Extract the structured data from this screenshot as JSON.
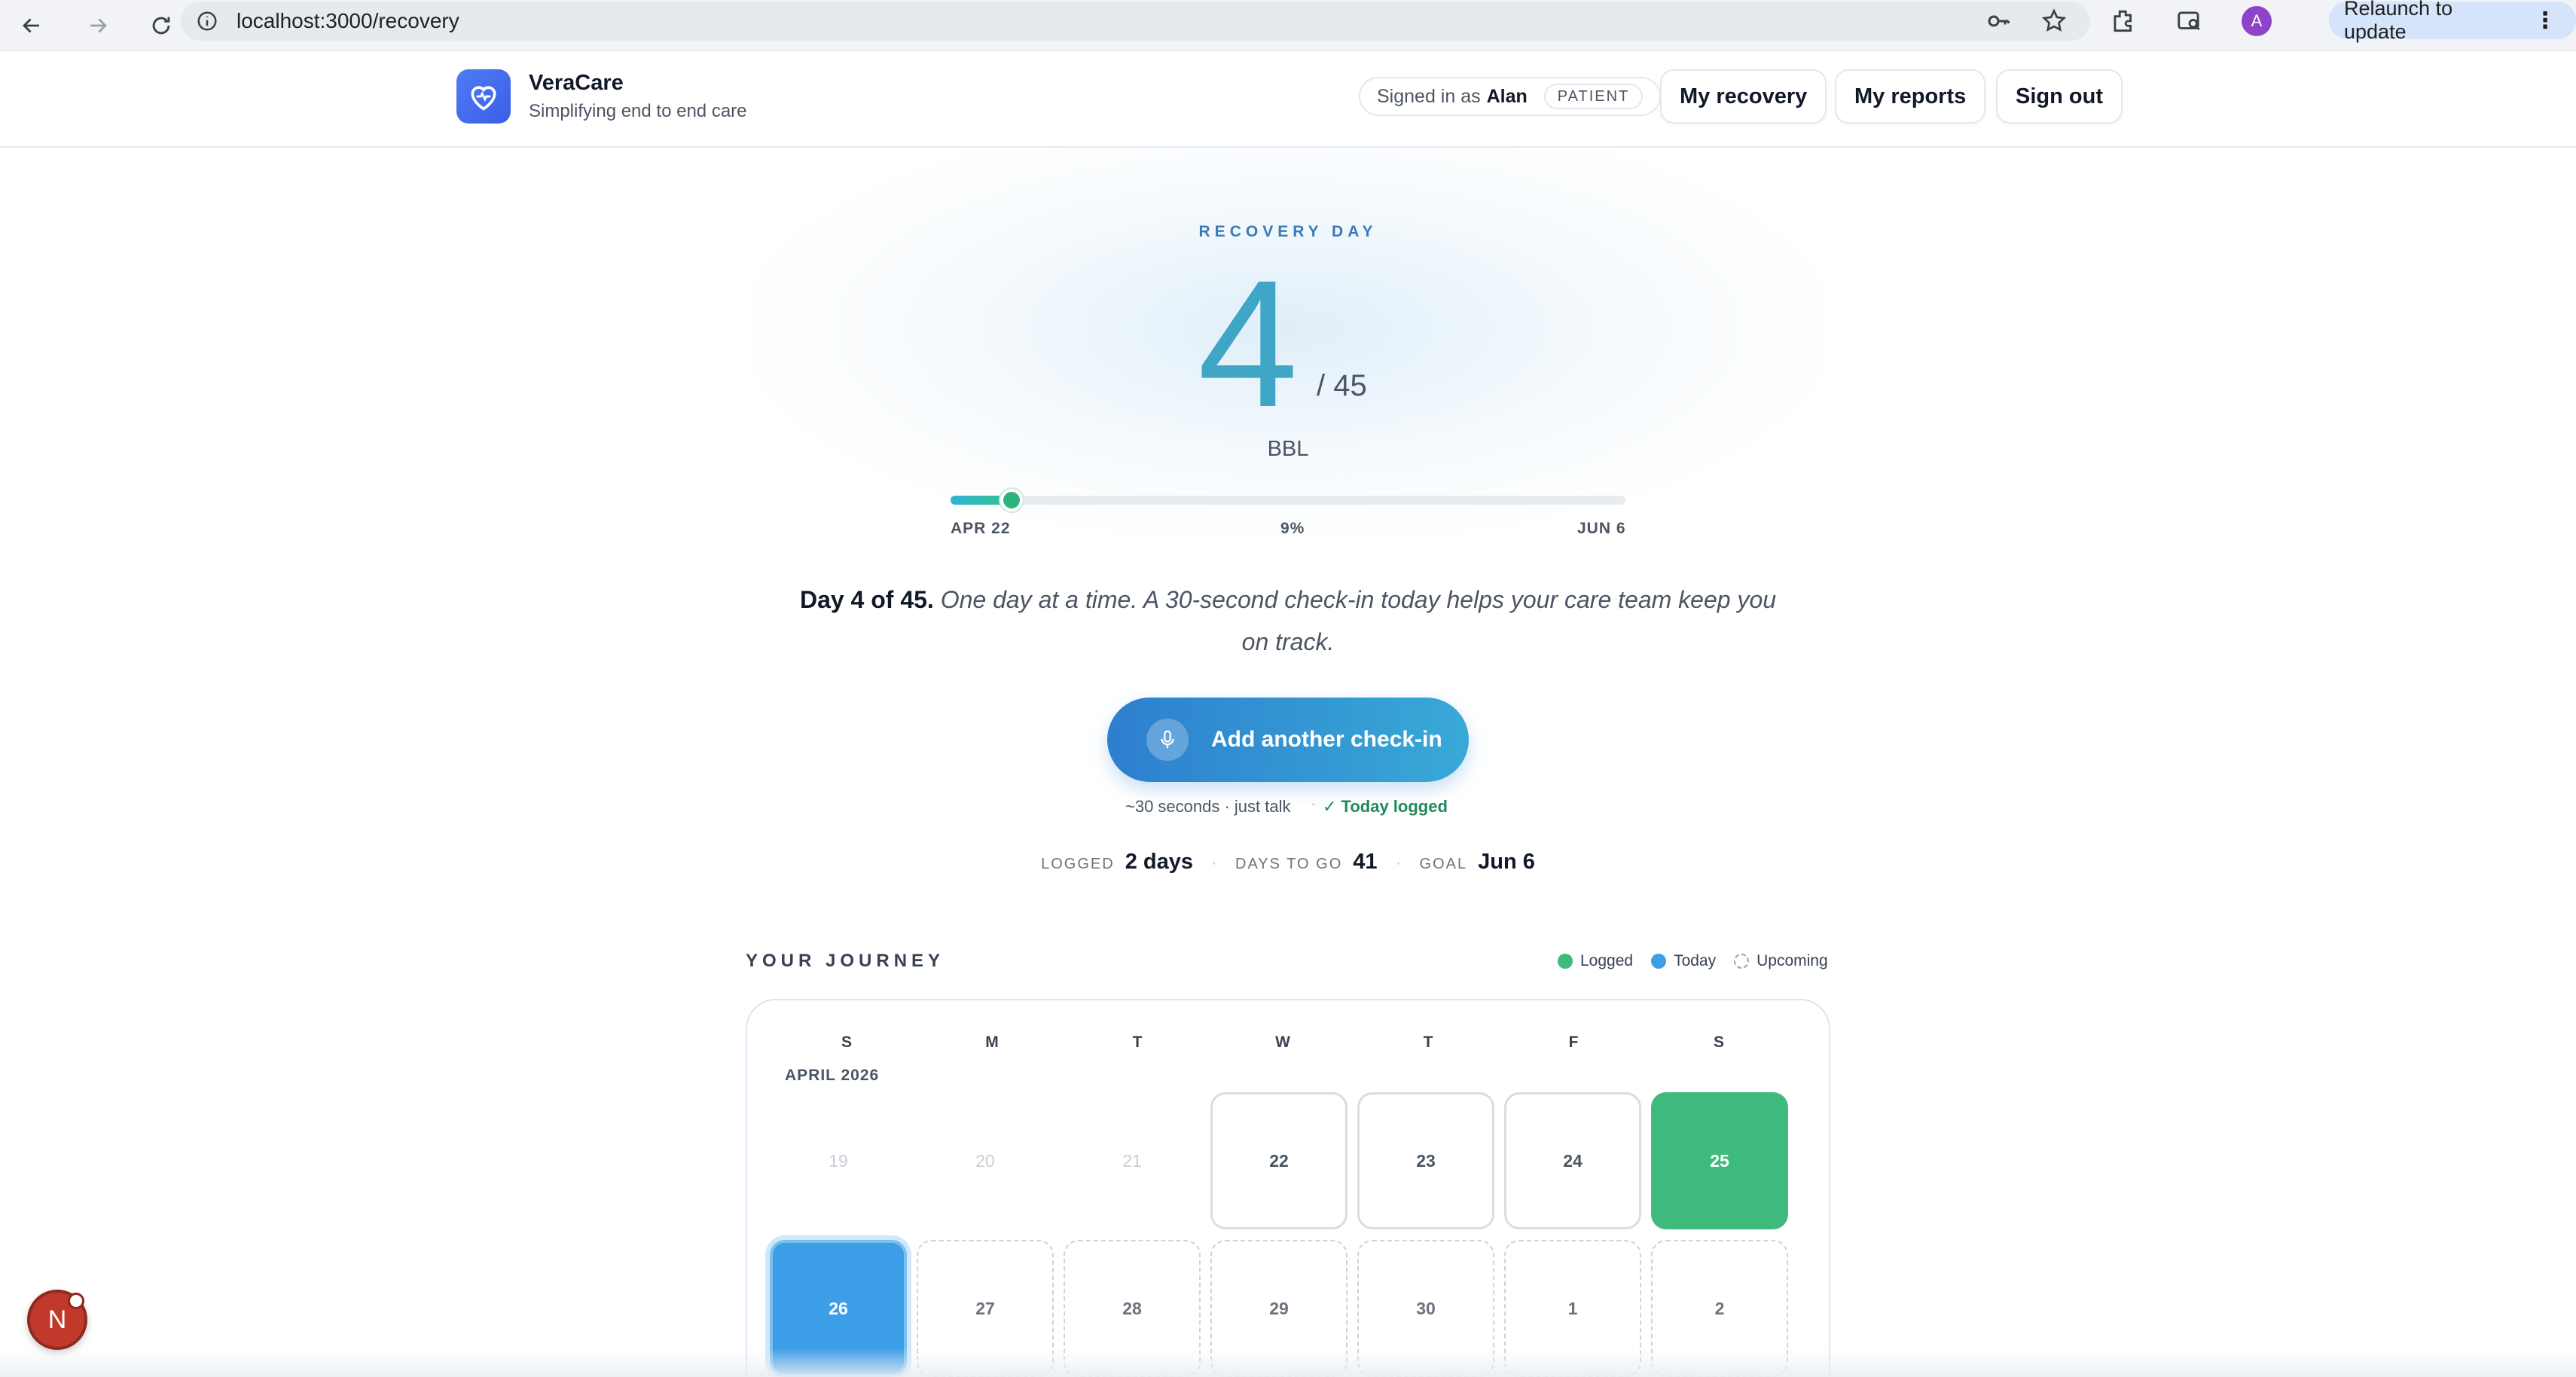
{
  "browser": {
    "url": "localhost:3000/recovery",
    "avatar_letter": "A",
    "relaunch_label": "Relaunch to update"
  },
  "header": {
    "brand_name": "VeraCare",
    "brand_tagline": "Simplifying end to end care",
    "signed_in_prefix": "Signed in as",
    "user_name": "Alan",
    "role": "PATIENT",
    "nav": {
      "my_recovery": "My recovery",
      "my_reports": "My reports",
      "sign_out": "Sign out"
    }
  },
  "recovery": {
    "eyebrow": "RECOVERY DAY",
    "day": "4",
    "total": "/ 45",
    "procedure": "BBL",
    "progress": {
      "start_label": "APR 22",
      "percent_label": "9%",
      "end_label": "JUN 6",
      "fraction": 0.09
    },
    "message_bold": "Day 4 of 45.",
    "message_italic": "One day at a time. A 30-second check-in today helps your care team keep you on track.",
    "cta_label": "Add another check-in",
    "cta_note": "~30 seconds · just talk",
    "today_status": "✓ Today logged",
    "stats": [
      {
        "key": "LOGGED",
        "value": "2 days"
      },
      {
        "key": "DAYS TO GO",
        "value": "41"
      },
      {
        "key": "GOAL",
        "value": "Jun 6"
      }
    ]
  },
  "journey": {
    "title": "YOUR JOURNEY",
    "legend": [
      {
        "label": "Logged",
        "color": "#3fba7d"
      },
      {
        "label": "Today",
        "color": "#3d9ee8"
      },
      {
        "label": "Upcoming",
        "color": "dashed"
      }
    ],
    "weekdays": [
      "S",
      "M",
      "T",
      "W",
      "T",
      "F",
      "S"
    ],
    "month_label": "APRIL 2026",
    "week1": [
      {
        "n": "19",
        "state": "past"
      },
      {
        "n": "20",
        "state": "past"
      },
      {
        "n": "21",
        "state": "past"
      },
      {
        "n": "22",
        "state": "open"
      },
      {
        "n": "23",
        "state": "open"
      },
      {
        "n": "24",
        "state": "open"
      },
      {
        "n": "25",
        "state": "logged"
      }
    ],
    "week2": [
      {
        "n": "26",
        "state": "today"
      },
      {
        "n": "27",
        "state": "upcoming"
      },
      {
        "n": "28",
        "state": "upcoming"
      },
      {
        "n": "29",
        "state": "upcoming"
      },
      {
        "n": "30",
        "state": "upcoming"
      },
      {
        "n": "1",
        "state": "upcoming"
      },
      {
        "n": "2",
        "state": "upcoming"
      }
    ]
  },
  "dev_badge": "N",
  "colors": {
    "accent": "#3fa6c8",
    "brand": "#4f7cf5",
    "logged": "#3fba7d",
    "today": "#3d9ee8"
  }
}
